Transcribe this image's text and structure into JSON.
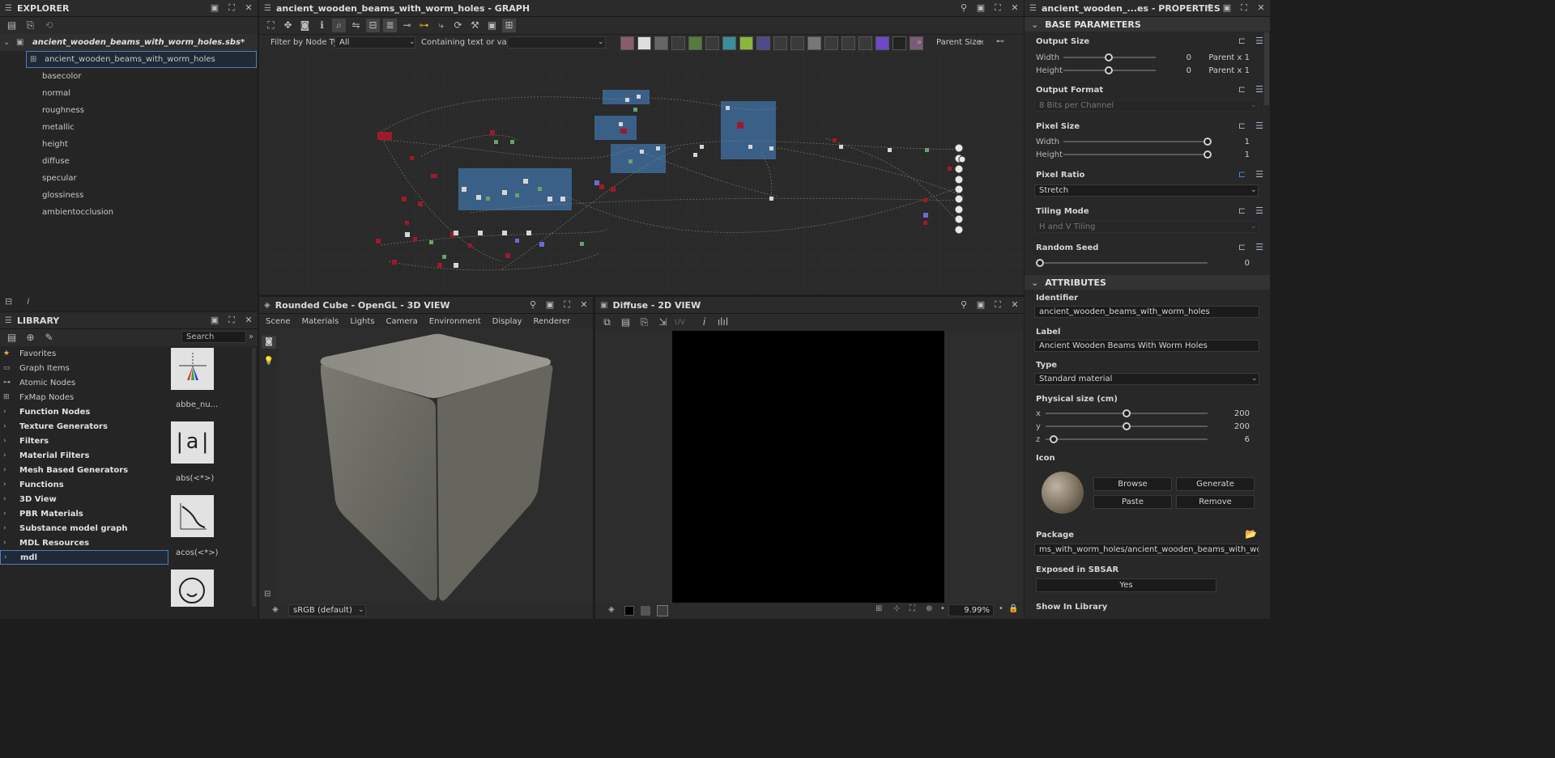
{
  "explorer": {
    "title": "EXPLORER",
    "package": "ancient_wooden_beams_with_worm_holes.sbs*",
    "graph": "ancient_wooden_beams_with_worm_holes",
    "outputs": [
      "basecolor",
      "normal",
      "roughness",
      "metallic",
      "height",
      "diffuse",
      "specular",
      "glossiness",
      "ambientocclusion"
    ]
  },
  "graph": {
    "title": "ancient_wooden_beams_with_worm_holes - GRAPH",
    "filter_label": "Filter by Node Type",
    "filter_value": "All",
    "contains_label": "Containing text or variable",
    "parent_size": "Parent Size:"
  },
  "library": {
    "title": "LIBRARY",
    "search_placeholder": "Search",
    "items": [
      {
        "label": "Favorites",
        "bold": false,
        "icon": "star"
      },
      {
        "label": "Graph Items",
        "bold": false,
        "icon": "comment"
      },
      {
        "label": "Atomic Nodes",
        "bold": false,
        "icon": "nodes"
      },
      {
        "label": "FxMap Nodes",
        "bold": false,
        "icon": "grid"
      },
      {
        "label": "Function Nodes",
        "bold": true
      },
      {
        "label": "Texture Generators",
        "bold": true
      },
      {
        "label": "Filters",
        "bold": true
      },
      {
        "label": "Material Filters",
        "bold": true
      },
      {
        "label": "Mesh Based Generators",
        "bold": true
      },
      {
        "label": "Functions",
        "bold": true
      },
      {
        "label": "3D View",
        "bold": true
      },
      {
        "label": "PBR Materials",
        "bold": true
      },
      {
        "label": "Substance model graph",
        "bold": true
      },
      {
        "label": "MDL Resources",
        "bold": true
      },
      {
        "label": "mdl",
        "bold": true
      }
    ],
    "thumbs": [
      "abbe_nu...",
      "abs(<*>)",
      "acos(<*>)"
    ]
  },
  "view3d": {
    "title": "Rounded Cube - OpenGL - 3D VIEW",
    "menu": [
      "Scene",
      "Materials",
      "Lights",
      "Camera",
      "Environment",
      "Display",
      "Renderer"
    ],
    "colorspace": "sRGB (default)"
  },
  "view2d": {
    "title": "Diffuse - 2D VIEW",
    "uv": "UV",
    "zoom": "9.99%"
  },
  "props": {
    "title": "ancient_wooden_...es - PROPERTIES",
    "base": "BASE PARAMETERS",
    "output_size": "Output Size",
    "width": "Width",
    "height": "Height",
    "os_w": "0",
    "os_h": "0",
    "parent": "Parent x 1",
    "output_format": "Output Format",
    "format_value": "8 Bits per Channel",
    "pixel_size": "Pixel Size",
    "ps_w": "1",
    "ps_h": "1",
    "pixel_ratio": "Pixel Ratio",
    "ratio_value": "Stretch",
    "tiling": "Tiling Mode",
    "tiling_value": "H and V Tiling",
    "seed": "Random Seed",
    "seed_value": "0",
    "attributes": "ATTRIBUTES",
    "identifier": "Identifier",
    "identifier_value": "ancient_wooden_beams_with_worm_holes",
    "label": "Label",
    "label_value": "Ancient Wooden Beams With Worm Holes",
    "type": "Type",
    "type_value": "Standard material",
    "phys": "Physical size (cm)",
    "px": "x",
    "py": "y",
    "pz": "z",
    "px_v": "200",
    "py_v": "200",
    "pz_v": "6",
    "icon": "Icon",
    "browse": "Browse",
    "generate": "Generate",
    "paste": "Paste",
    "remove": "Remove",
    "package": "Package",
    "package_value": "ms_with_worm_holes/ancient_wooden_beams_with_worm_holes.sbs",
    "exposed": "Exposed in SBSAR",
    "exposed_value": "Yes",
    "show": "Show In Library"
  }
}
